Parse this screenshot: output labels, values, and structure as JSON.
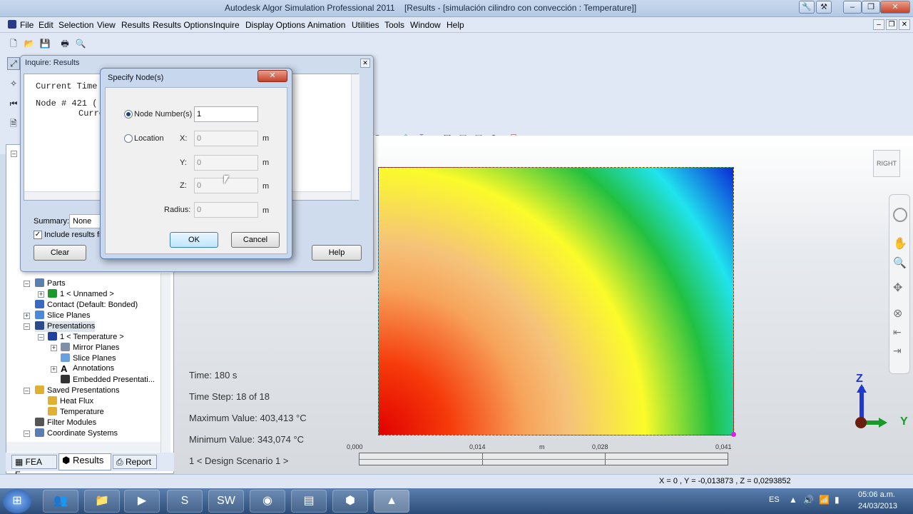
{
  "window": {
    "app_title": "Autodesk Algor Simulation Professional 2011",
    "doc_title": "[Results - [simulación cilindro con convección : Temperature]]"
  },
  "menu": [
    "File",
    "Edit",
    "Selection",
    "View",
    "Results",
    "Results Options",
    "Inquire",
    "Display Options",
    "Animation",
    "Utilities",
    "Tools",
    "Window",
    "Help"
  ],
  "tree": {
    "items": [
      "Parts",
      "1 < Unnamed >",
      "Contact (Default: Bonded)",
      "Slice Planes",
      "Presentations",
      "1 < Temperature >",
      "Mirror Planes",
      "Slice Planes",
      "Annotations",
      "Embedded Presentati...",
      "Saved Presentations",
      "Heat Flux",
      "Temperature",
      "Filter Modules",
      "Coordinate Systems"
    ]
  },
  "tabs": {
    "fea": "FEA E...",
    "results": "Results",
    "report": "Report"
  },
  "viewport": {
    "time": "Time: 180 s",
    "step": "Time Step:  18 of 18",
    "max": "Maximum Value: 403,413 °C",
    "min": "Minimum Value: 343,074 °C",
    "scenario": "1 < Design Scenario 1 >",
    "scale_ticks": [
      "0,000",
      "0,014",
      "m",
      "0,028",
      "0,041"
    ],
    "view_cube": "RIGHT",
    "axis_z": "Z",
    "axis_y": "Y"
  },
  "status": {
    "coords": "X =  0 , Y =  -0,013873 , Z =  0,0293852"
  },
  "inquire": {
    "title": "Inquire: Results",
    "line1": "Current Time",
    "line2": "Node # 421 (",
    "line3": "Curre",
    "summary_label": "Summary:",
    "summary_value": "None",
    "include_label": "Include results from",
    "clear": "Clear",
    "help": "Help"
  },
  "specify": {
    "title": "Specify Node(s)",
    "node_label": "Node Number(s)",
    "node_value": "1",
    "location_label": "Location",
    "x_label": "X:",
    "x_value": "0",
    "x_unit": "m",
    "y_label": "Y:",
    "y_value": "0",
    "y_unit": "m",
    "z_label": "Z:",
    "z_value": "0",
    "z_unit": "m",
    "radius_label": "Radius:",
    "radius_value": "0",
    "radius_unit": "m",
    "ok": "OK",
    "cancel": "Cancel"
  },
  "taskbar": {
    "lang": "ES",
    "time": "05:06 a.m.",
    "date": "24/03/2013"
  }
}
